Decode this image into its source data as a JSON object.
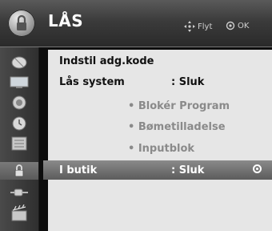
{
  "header": {
    "title": "LÅS",
    "move_hint": "Flyt",
    "ok_hint": "OK"
  },
  "sidebar": {
    "items": [
      {
        "icon": "satellite-dish-icon"
      },
      {
        "icon": "monitor-icon"
      },
      {
        "icon": "speaker-icon"
      },
      {
        "icon": "clock-icon"
      },
      {
        "icon": "settings-panel-icon"
      },
      {
        "icon": "lock-icon",
        "active": true
      },
      {
        "icon": "input-plug-icon"
      },
      {
        "icon": "media-icon"
      }
    ]
  },
  "menu": {
    "items": [
      {
        "label": "Indstil adg.kode",
        "value": "",
        "state": "enabled"
      },
      {
        "label": "Lås system",
        "value": ": Sluk",
        "state": "enabled"
      },
      {
        "label": "• Blokér Program",
        "value": "",
        "state": "disabled"
      },
      {
        "label": "• Bømetilladelse",
        "value": "",
        "state": "disabled"
      },
      {
        "label": "• Inputblok",
        "value": "",
        "state": "disabled"
      },
      {
        "label": "I butik",
        "value": ": Sluk",
        "state": "selected"
      }
    ]
  },
  "colors": {
    "header_top": "#5a5a5a",
    "panel_bg": "#e6e6e6",
    "selected_row": "#6e6e6e",
    "disabled_text": "#8a8a8a"
  }
}
